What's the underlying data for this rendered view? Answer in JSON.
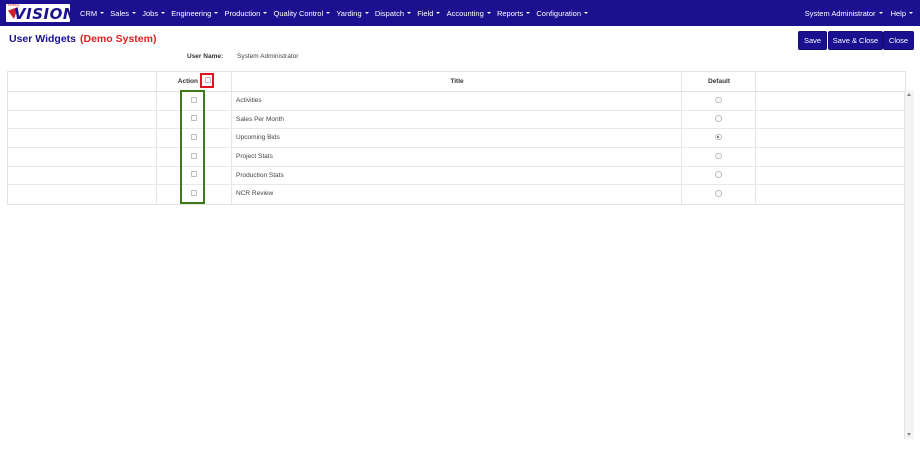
{
  "app": {
    "logo_text": "VISION",
    "logo_tag": "MOBILE",
    "brand_color": "#1a1090",
    "accent_color": "#e02020"
  },
  "nav": {
    "items": [
      "CRM",
      "Sales",
      "Jobs",
      "Engineering",
      "Production",
      "Quality Control",
      "Yarding",
      "Dispatch",
      "Field",
      "Accounting",
      "Reports",
      "Configuration"
    ],
    "user": "System Administrator",
    "help": "Help"
  },
  "page": {
    "title": "User Widgets",
    "subtitle": "(Demo System)",
    "user_name_label": "User Name:",
    "user_name_value": "System Administrator"
  },
  "toolbar": {
    "save_label": "Save",
    "save_close_label": "Save & Close",
    "close_label": "Close"
  },
  "table": {
    "columns": {
      "action": "Action",
      "title": "Title",
      "default": "Default"
    },
    "rows": [
      {
        "title": "Activities",
        "checked": false,
        "default": false
      },
      {
        "title": "Sales Per Month",
        "checked": false,
        "default": false
      },
      {
        "title": "Upcoming Bids",
        "checked": false,
        "default": true
      },
      {
        "title": "Project Stats",
        "checked": false,
        "default": false
      },
      {
        "title": "Production Stats",
        "checked": false,
        "default": false
      },
      {
        "title": "NCR Review",
        "checked": false,
        "default": false
      }
    ]
  },
  "annotations": {
    "header_checkbox_highlight": "#e0141e",
    "row_checkboxes_highlight": "#3e7a1d"
  }
}
